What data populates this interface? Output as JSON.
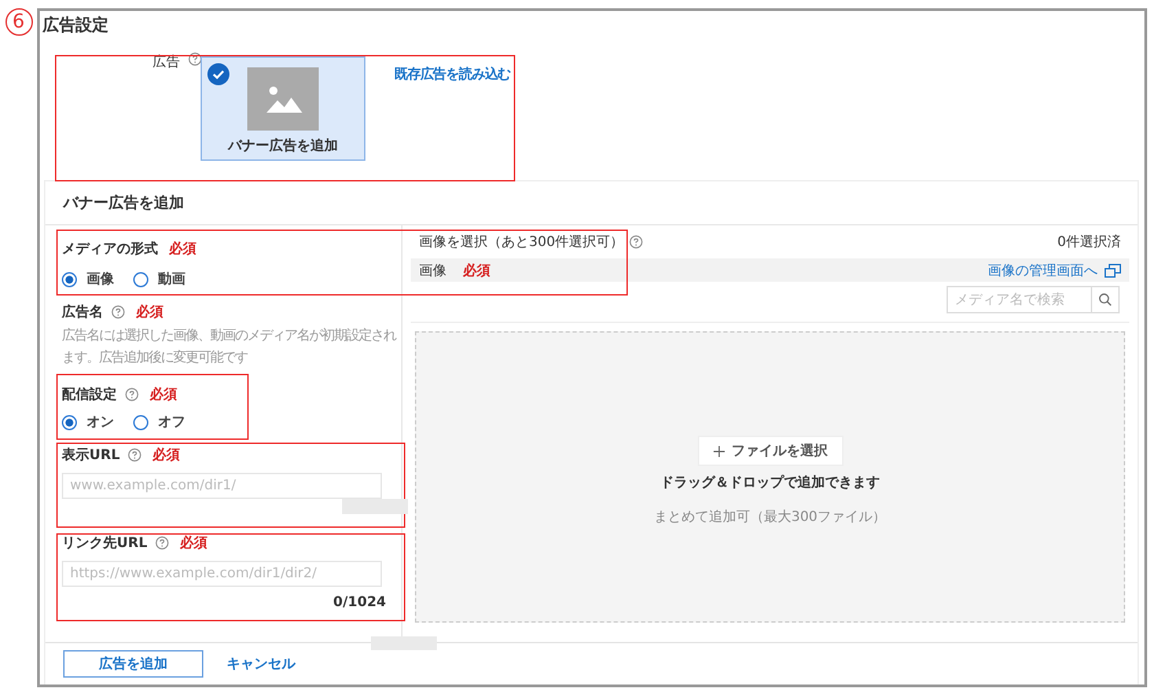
{
  "step_badge": "6",
  "section_title": "広告設定",
  "ad": {
    "label": "広告",
    "card": {
      "label": "バナー広告を追加",
      "selected": true
    },
    "load_link": "既存広告を読み込む"
  },
  "panel": {
    "title": "バナー広告を追加",
    "media_format": {
      "label": "メディアの形式",
      "required": "必須",
      "options": [
        {
          "label": "画像",
          "selected": true
        },
        {
          "label": "動画",
          "selected": false
        }
      ]
    },
    "ad_name": {
      "label": "広告名",
      "required": "必須",
      "help": "広告名には選択した画像、動画のメディア名が初期設定されます。広告追加後に変更可能です"
    },
    "delivery": {
      "label": "配信設定",
      "required": "必須",
      "options": [
        {
          "label": "オン",
          "selected": true
        },
        {
          "label": "オフ",
          "selected": false
        }
      ]
    },
    "display_url": {
      "label": "表示URL",
      "required": "必須",
      "placeholder": "www.example.com/dir1/"
    },
    "link_url": {
      "label": "リンク先URL",
      "required": "必須",
      "placeholder": "https://www.example.com/dir1/dir2/",
      "counter": "0/1024"
    },
    "image_picker": {
      "title": "画像を選択（あと300件選択可）",
      "selected_count": "0件選択済",
      "field_label": "画像",
      "required": "必須",
      "manage_link": "画像の管理画面へ",
      "search_placeholder": "メディア名で検索",
      "choose_button": "ファイルを選択",
      "drop_text": "ドラッグ＆ドロップで追加できます",
      "note": "まとめて追加可（最大300ファイル）"
    }
  },
  "footer": {
    "submit": "広告を追加",
    "cancel": "キャンセル"
  }
}
